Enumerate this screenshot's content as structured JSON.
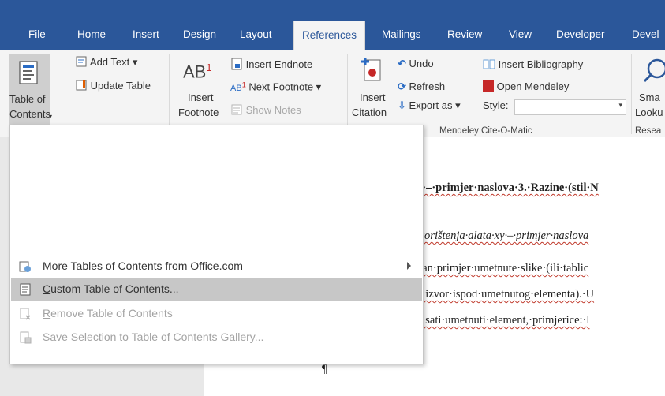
{
  "colors": {
    "ribbon_blue": "#2b579a",
    "hover": "#c7c7c7",
    "mendeley_red": "#c62828"
  },
  "tabs": [
    "File",
    "Home",
    "Insert",
    "Design",
    "Layout",
    "References",
    "Mailings",
    "Review",
    "View",
    "Developer",
    "Devel"
  ],
  "active_tab": "References",
  "ribbon": {
    "toc_label1": "Table of",
    "toc_label2": "Contents",
    "add_text": "Add Text",
    "update_table": "Update Table",
    "insert_footnote1": "Insert",
    "insert_footnote2": "Footnote",
    "ab_big": "AB",
    "insert_endnote": "Insert Endnote",
    "next_footnote": "Next Footnote",
    "show_notes": "Show Notes",
    "insert_citation1": "Insert",
    "insert_citation2": "Citation",
    "undo": "Undo",
    "refresh": "Refresh",
    "export_as": "Export as",
    "style_label": "Style:",
    "insert_bibliography": "Insert Bibliography",
    "open_mendeley": "Open Mendeley",
    "group_mendeley": "Mendeley Cite-O-Matic",
    "smart_lookup1": "Sma",
    "smart_lookup2": "Looku",
    "group_research": "Resea"
  },
  "document": {
    "line1": "y·–·primjer·naslova·3.·Razine·(stil·N",
    "line2": "·korištenja·alata·xy·–·primjer·naslova",
    "line3": "dan·primjer·umetnute·slike·(ili·tablic",
    "line4": "a·izvor·ispod·umetnutog·elementa).·U",
    "line5": "pisati·umetnuti·element,·primjerice:·l",
    "pilcrow": "¶"
  },
  "menu": {
    "items": [
      {
        "label": "More Tables of Contents from Office.com",
        "icon": "office-web-icon"
      },
      {
        "label": "Custom Table of Contents...",
        "icon": "document-icon"
      },
      {
        "label": "Remove Table of Contents",
        "icon": "remove-toc-icon"
      },
      {
        "label": "Save Selection to Table of Contents Gallery...",
        "icon": "save-gallery-icon"
      }
    ]
  }
}
